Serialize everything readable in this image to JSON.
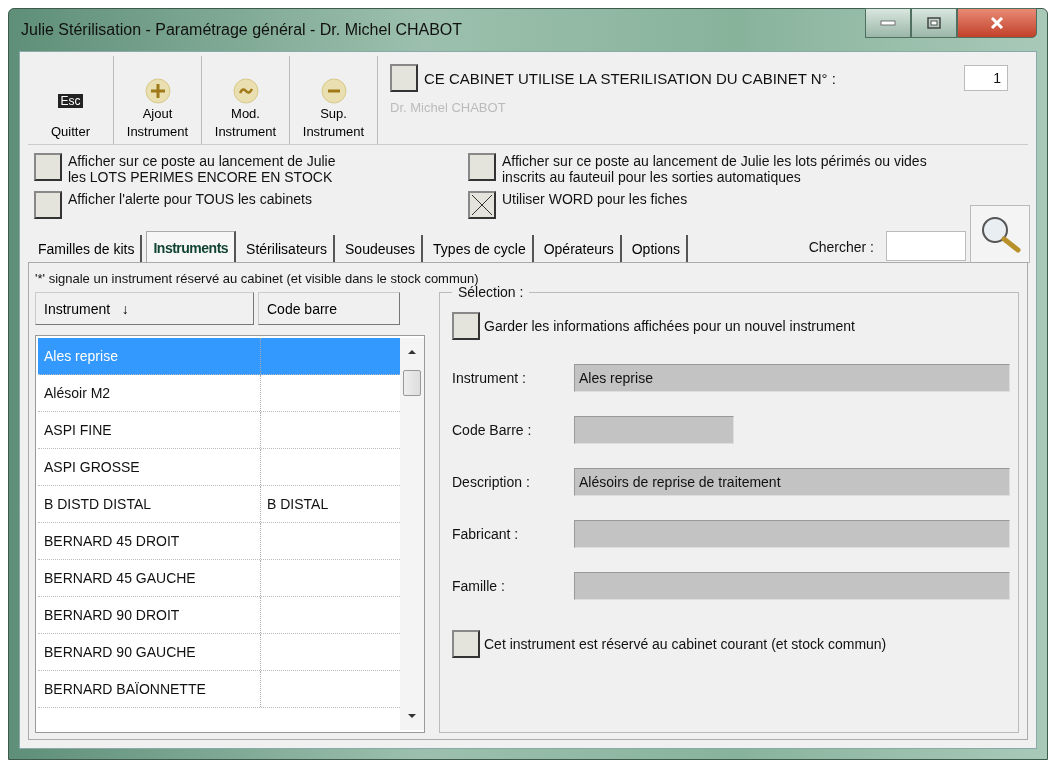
{
  "window": {
    "title": "Julie Stérilisation - Paramétrage général - Dr. Michel CHABOT"
  },
  "toolbar": {
    "buttons": [
      {
        "kind": "esc",
        "key": "Esc",
        "label": "Quitter"
      },
      {
        "kind": "add",
        "top": "Ajout",
        "label": "Instrument"
      },
      {
        "kind": "edit",
        "top": "Mod.",
        "label": "Instrument"
      },
      {
        "kind": "remove",
        "top": "Sup.",
        "label": "Instrument"
      }
    ]
  },
  "cabinet": {
    "checked": false,
    "label": "CE CABINET UTILISE LA STERILISATION DU CABINET N° :",
    "number": "1",
    "doctor": "Dr. Michel CHABOT"
  },
  "options": [
    {
      "checked": false,
      "lines": [
        "Afficher sur ce poste au lancement de Julie",
        "les LOTS PERIMES ENCORE EN STOCK"
      ]
    },
    {
      "checked": false,
      "lines": [
        "Afficher sur ce poste au lancement de Julie les lots périmés ou vides",
        "inscrits au fauteuil pour les sorties automatiques"
      ]
    },
    {
      "checked": false,
      "lines": [
        "Afficher l'alerte pour TOUS les cabinets"
      ]
    },
    {
      "checked": true,
      "lines": [
        "Utiliser WORD pour les fiches"
      ]
    }
  ],
  "search": {
    "label": "Chercher :"
  },
  "tabs": [
    {
      "label": "Familles de kits",
      "selected": false
    },
    {
      "label": "Instruments",
      "selected": true
    },
    {
      "label": "Stérilisateurs",
      "selected": false
    },
    {
      "label": "Soudeuses",
      "selected": false
    },
    {
      "label": "Types de cycle",
      "selected": false
    },
    {
      "label": "Opérateurs",
      "selected": false
    },
    {
      "label": "Options",
      "selected": false
    }
  ],
  "note": "'*' signale un instrument réservé au cabinet (et visible dans le stock commun)",
  "table": {
    "columns": [
      {
        "label": "Instrument",
        "sort": "↓"
      },
      {
        "label": "Code barre"
      }
    ],
    "rows": [
      {
        "cells": [
          "Ales reprise",
          ""
        ],
        "selected": true
      },
      {
        "cells": [
          "Alésoir M2",
          ""
        ],
        "selected": false
      },
      {
        "cells": [
          "ASPI FINE",
          ""
        ],
        "selected": false
      },
      {
        "cells": [
          "ASPI GROSSE",
          ""
        ],
        "selected": false
      },
      {
        "cells": [
          "B DISTD DISTAL",
          "B DISTAL"
        ],
        "selected": false
      },
      {
        "cells": [
          "BERNARD 45 DROIT",
          ""
        ],
        "selected": false
      },
      {
        "cells": [
          "BERNARD 45 GAUCHE",
          ""
        ],
        "selected": false
      },
      {
        "cells": [
          "BERNARD 90 DROIT",
          ""
        ],
        "selected": false
      },
      {
        "cells": [
          "BERNARD 90 GAUCHE",
          ""
        ],
        "selected": false
      },
      {
        "cells": [
          "BERNARD BAÏONNETTE",
          ""
        ],
        "selected": false
      }
    ]
  },
  "selection": {
    "legend": "Sélection :",
    "keep": {
      "checked": false,
      "label": "Garder les informations affichées pour un nouvel instrument"
    },
    "fields": [
      {
        "label": "Instrument :",
        "value": "Ales reprise",
        "kind": "wide"
      },
      {
        "label": "Code Barre :",
        "kind": "short"
      },
      {
        "label": "Description :",
        "value": "Alésoirs de reprise de traitement",
        "kind": "wide"
      },
      {
        "label": "Fabricant :",
        "kind": "wide"
      },
      {
        "label": "Famille :",
        "kind": "wide"
      }
    ],
    "reserved": {
      "checked": false,
      "label": "Cet instrument est réservé au cabinet courant (et stock commun)"
    }
  }
}
